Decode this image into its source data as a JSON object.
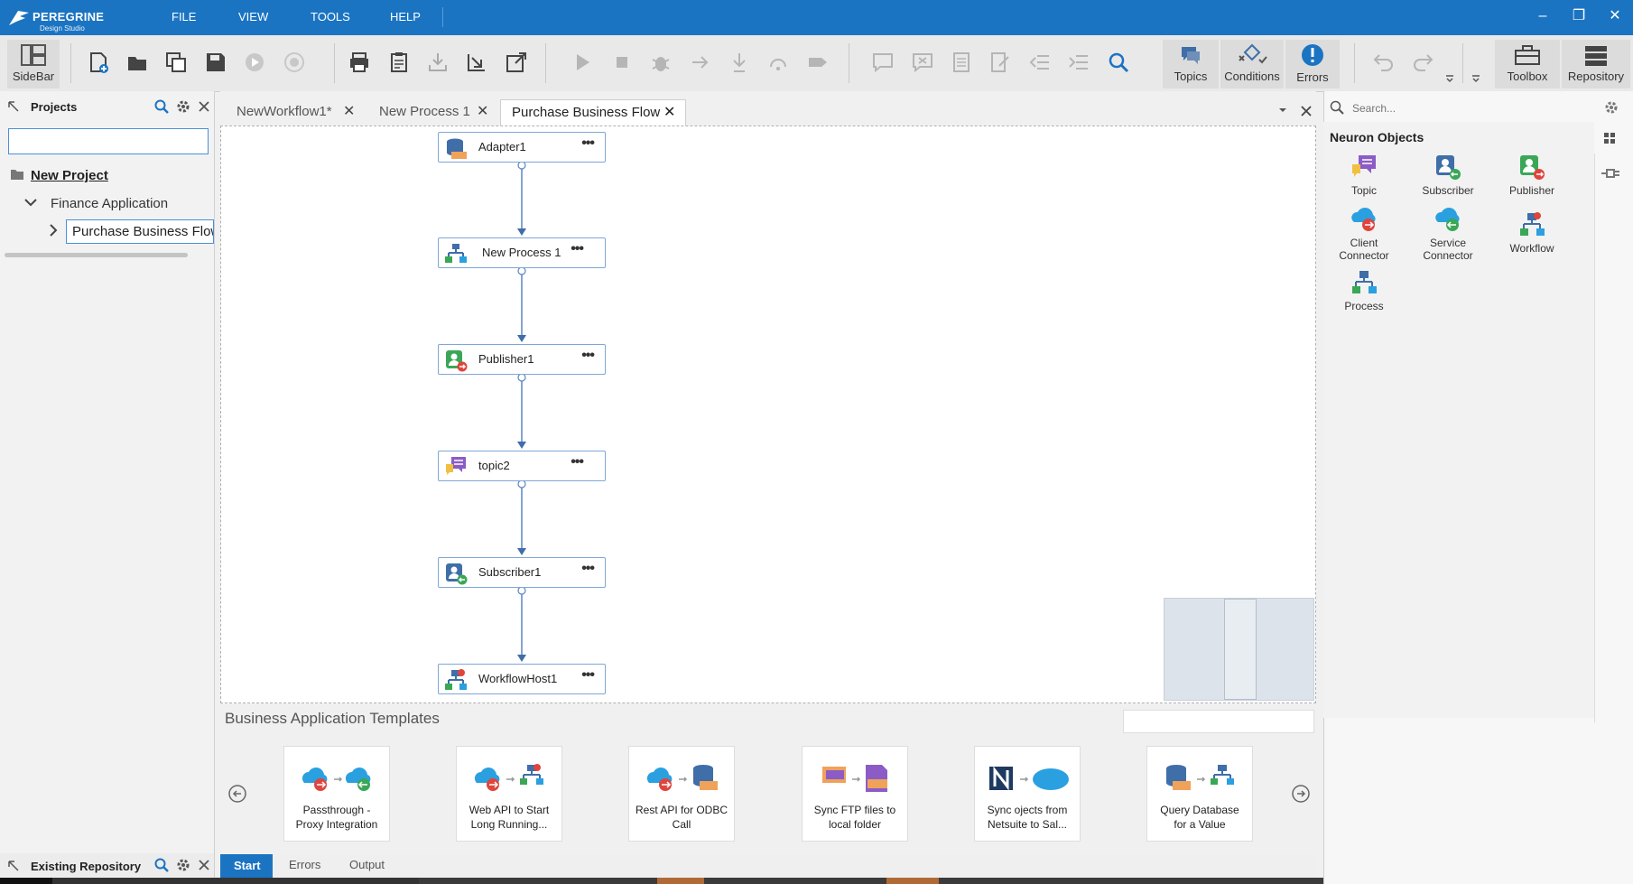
{
  "app": {
    "brand": "PEREGRINE",
    "subtitle": "Design Studio"
  },
  "menu": [
    "FILE",
    "VIEW",
    "TOOLS",
    "HELP"
  ],
  "toolbar": {
    "sidebar_label": "SideBar",
    "topics_label": "Topics",
    "conditions_label": "Conditions",
    "errors_label": "Errors",
    "toolbox_label": "Toolbox",
    "repository_label": "Repository"
  },
  "projects": {
    "header": "Projects",
    "filter_value": "",
    "tree": {
      "root": "New Project",
      "child": "Finance Application",
      "grandchild": "Purchase Business Flow"
    }
  },
  "existing_repo": {
    "header": "Existing Repository"
  },
  "tabs": [
    {
      "label": "NewWorkflow1*"
    },
    {
      "label": "New Process 1"
    },
    {
      "label": "Purchase Business Flow"
    }
  ],
  "flow_nodes": [
    {
      "label": "Adapter1",
      "icon": "odbc-adapter-icon"
    },
    {
      "label": "New Process 1",
      "icon": "process-icon"
    },
    {
      "label": "Publisher1",
      "icon": "publisher-icon"
    },
    {
      "label": "topic2",
      "icon": "topic-icon"
    },
    {
      "label": "Subscriber1",
      "icon": "subscriber-icon"
    },
    {
      "label": "WorkflowHost1",
      "icon": "workflow-icon"
    }
  ],
  "templates": {
    "title": "Business Application Templates",
    "items": [
      {
        "line1": "Passthrough -",
        "line2": "Proxy Integration"
      },
      {
        "line1": "Web API to Start",
        "line2": "Long Running..."
      },
      {
        "line1": "Rest API for ODBC",
        "line2": "Call"
      },
      {
        "line1": "Sync FTP files to",
        "line2": "local folder"
      },
      {
        "line1": "Sync ojects from",
        "line2": "Netsuite to Sal..."
      },
      {
        "line1": "Query Database",
        "line2": "for a Value"
      }
    ]
  },
  "bottom_tabs": [
    "Start",
    "Errors",
    "Output"
  ],
  "right": {
    "search_placeholder": "Search...",
    "section_title": "Neuron Objects",
    "objects": [
      {
        "line1": "Topic",
        "line2": ""
      },
      {
        "line1": "Subscriber",
        "line2": ""
      },
      {
        "line1": "Publisher",
        "line2": ""
      },
      {
        "line1": "Client",
        "line2": "Connector"
      },
      {
        "line1": "Service",
        "line2": "Connector"
      },
      {
        "line1": "Workflow",
        "line2": ""
      },
      {
        "line1": "Process",
        "line2": ""
      }
    ]
  },
  "colors": {
    "titlebar": "#1b74c2",
    "accent": "#1b74c2",
    "topic_purple": "#8b5cc6",
    "publisher_red": "#e0443c",
    "subscriber_green": "#3aa757",
    "cloud_blue": "#2aa0e0"
  }
}
